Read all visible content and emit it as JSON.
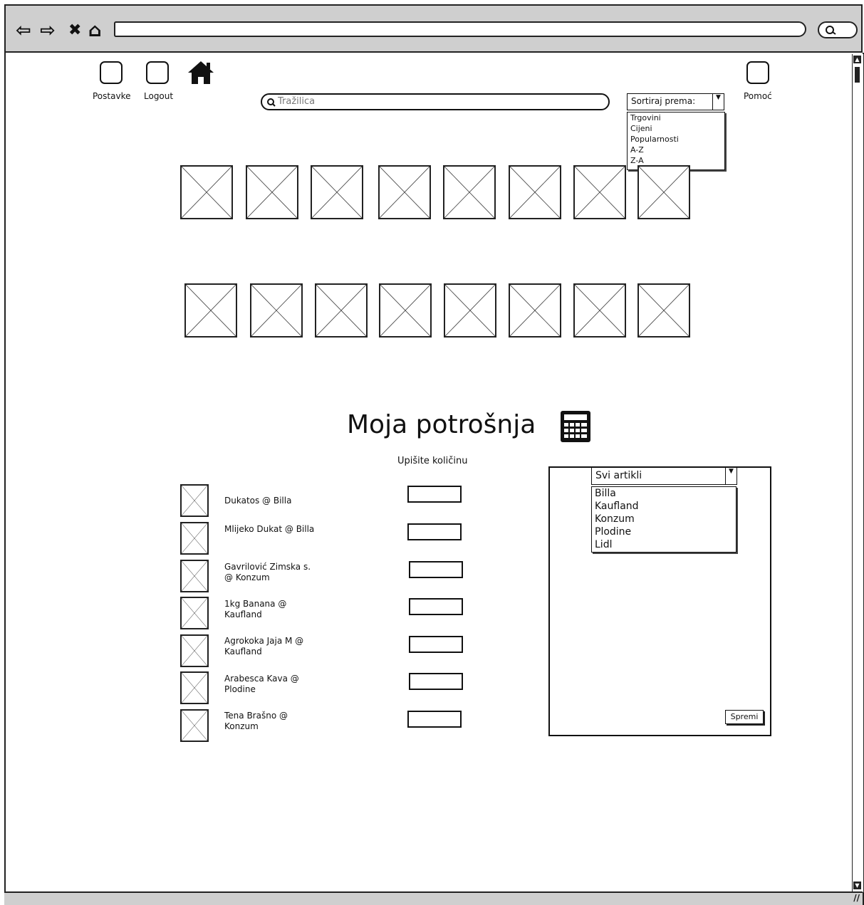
{
  "header": {
    "settings_label": "Postavke",
    "logout_label": "Logout",
    "help_label": "Pomoć"
  },
  "search": {
    "placeholder": "Tražilica"
  },
  "sort": {
    "label": "Sortiraj prema:",
    "options": [
      "Trgovini",
      "Cijeni",
      "Popularnosti",
      "A-Z",
      "Z-A"
    ]
  },
  "main": {
    "title": "Moja potrošnja",
    "quantity_header": "Upišite količinu",
    "products": [
      {
        "label": "Dukatos @ Billa"
      },
      {
        "label": "Mlijeko Dukat @ Billa"
      },
      {
        "label": "Gavrilović Zimska s. @ Konzum"
      },
      {
        "label": "1kg Banana @ Kaufland"
      },
      {
        "label": "Agrokoka Jaja M @ Kaufland"
      },
      {
        "label": "Arabesca Kava @ Plodine"
      },
      {
        "label": "Tena Brašno @ Konzum"
      }
    ]
  },
  "panel": {
    "filter_selected": "Svi artikli",
    "filter_options": [
      "Billa",
      "Kaufland",
      "Konzum",
      "Plodine",
      "Lidl"
    ],
    "save_label": "Spremi"
  },
  "icons": {
    "back": "arrow-left-icon",
    "forward": "arrow-right-icon",
    "stop": "close-icon",
    "home_browser": "home-icon",
    "home": "house-icon",
    "calculator": "calculator-icon"
  }
}
